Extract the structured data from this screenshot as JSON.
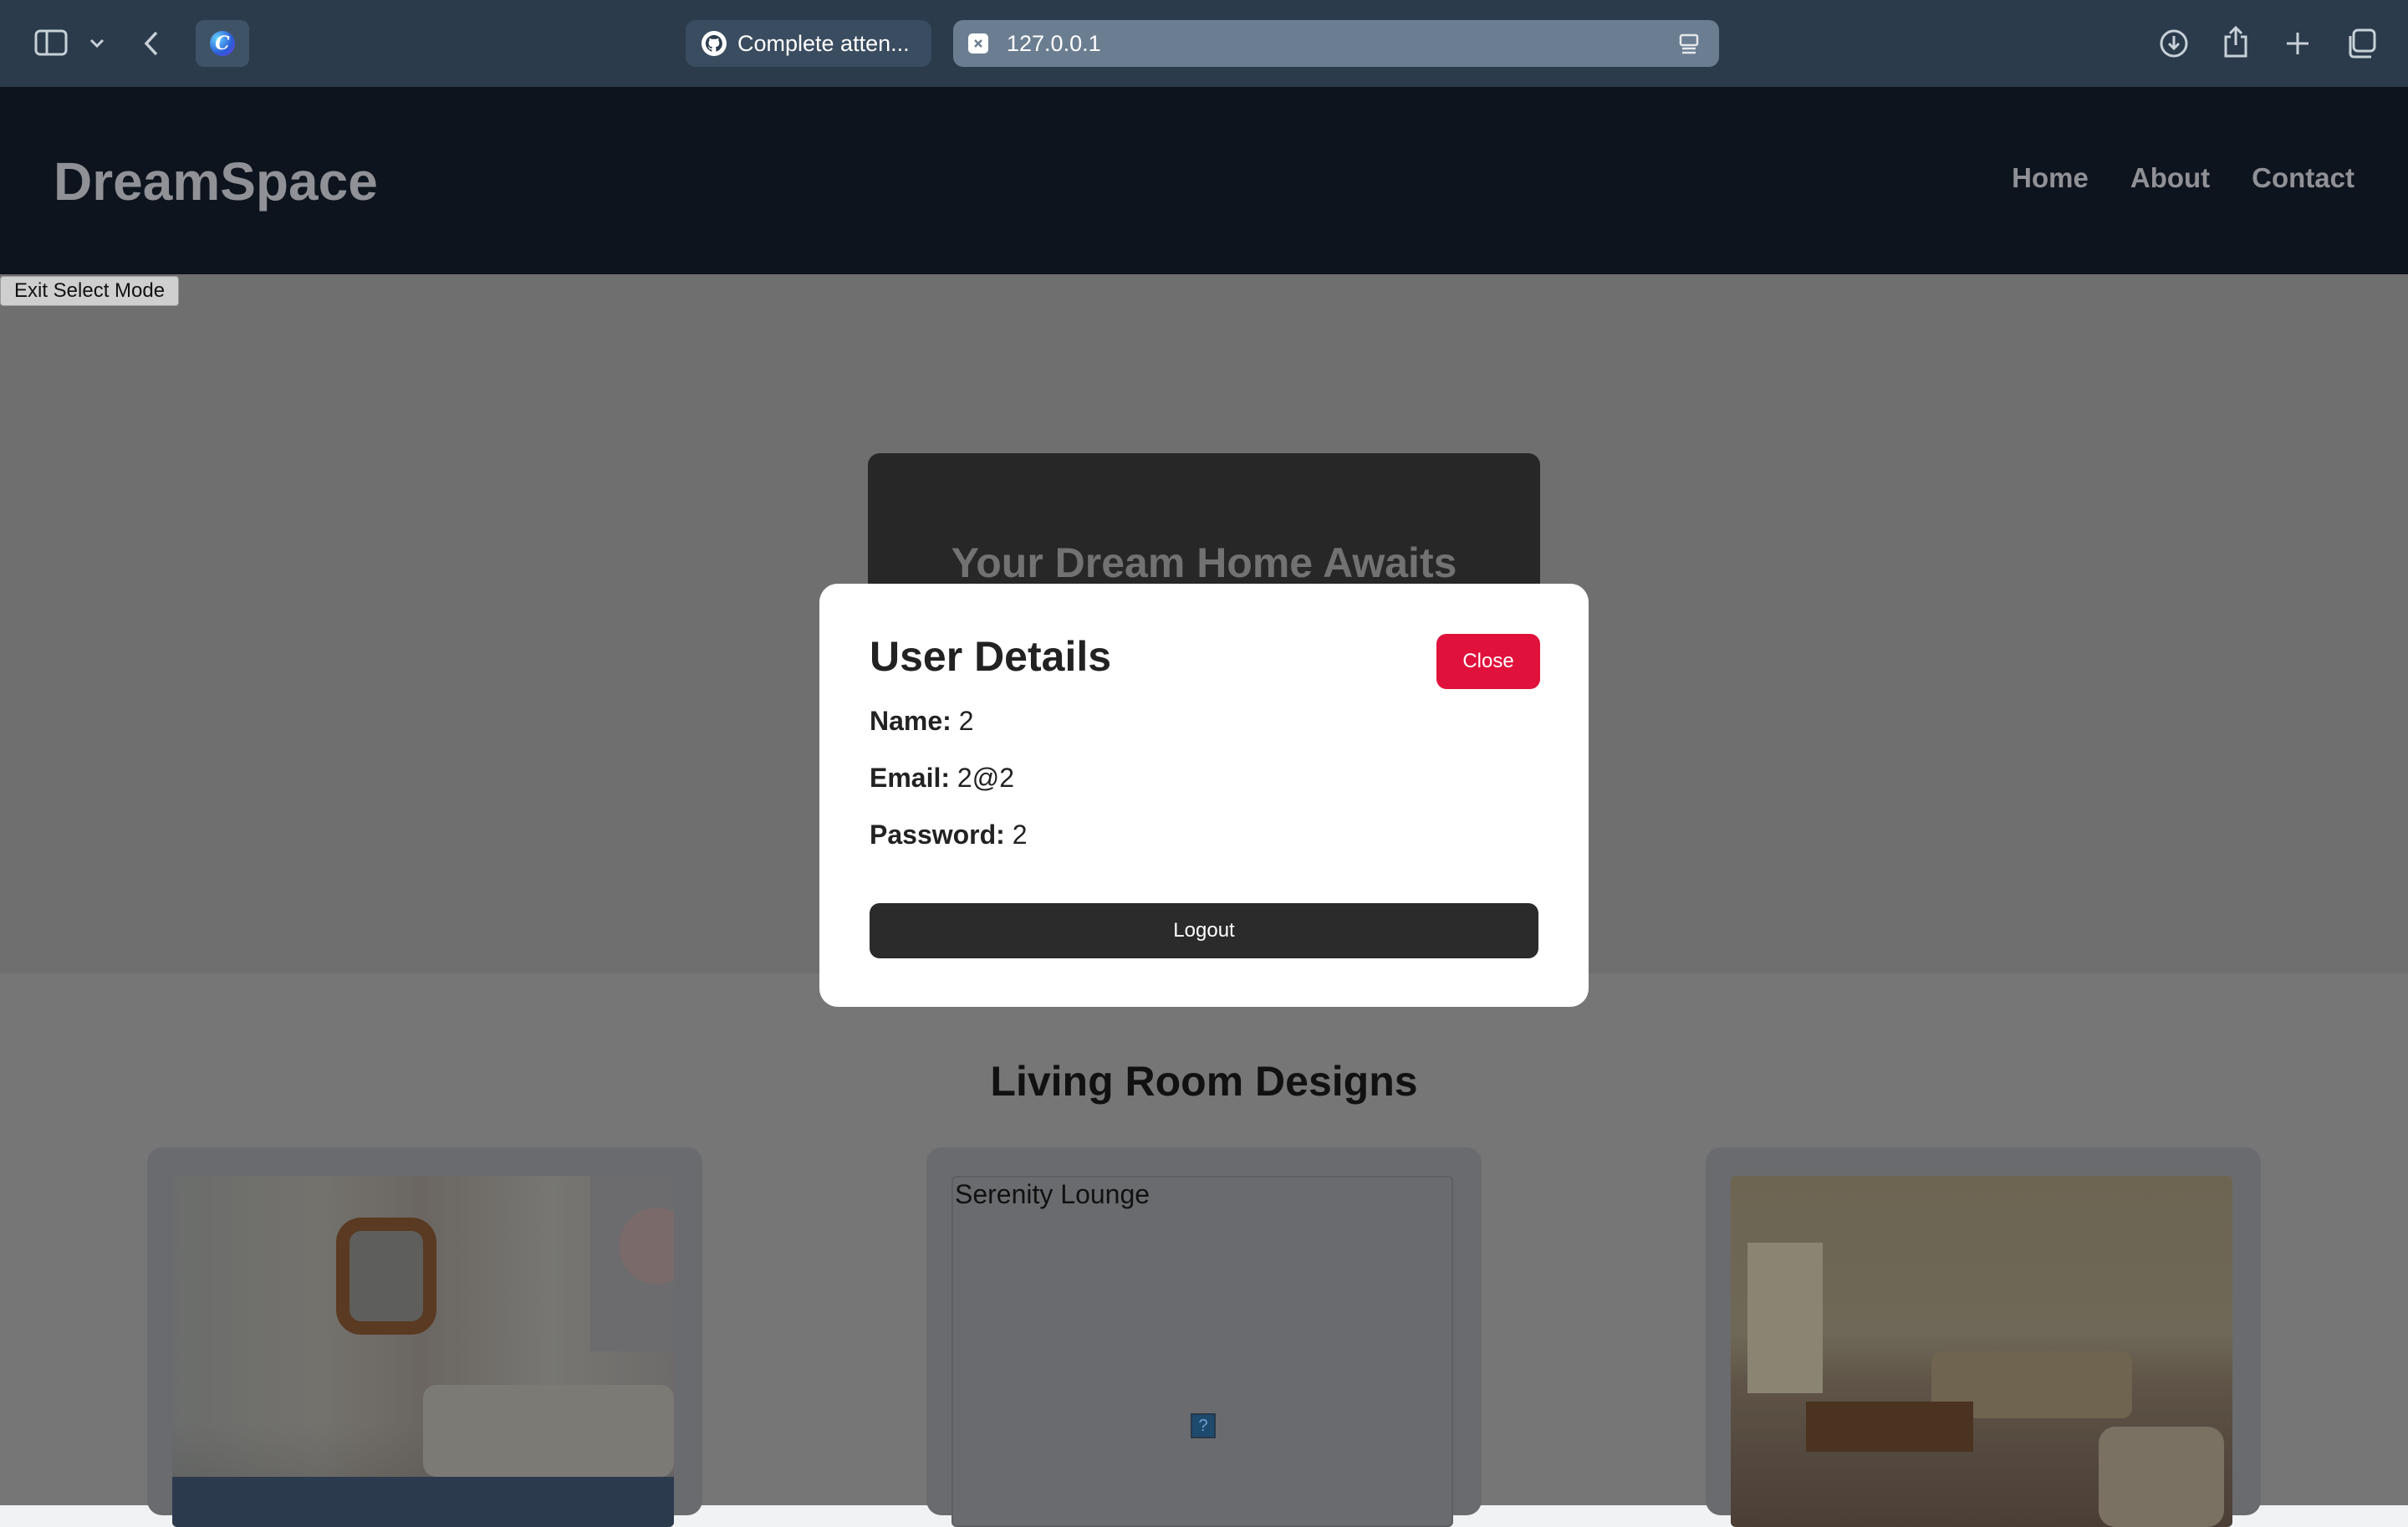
{
  "browser": {
    "tabs": [
      {
        "title": "Complete atten..."
      },
      {
        "title": "127.0.0.1"
      }
    ],
    "icons": {
      "sidebar": "sidebar-icon",
      "chevron": "chevron-down-icon",
      "back": "back-arrow-icon",
      "extension": "extension-icon",
      "download": "download-icon",
      "share": "share-icon",
      "new_tab": "plus-icon",
      "tab_overview": "tab-overview-icon"
    }
  },
  "site": {
    "logo": "DreamSpace",
    "nav": [
      "Home",
      "About",
      "Contact"
    ]
  },
  "overlay_toggle": "Exit Select Mode",
  "hero": {
    "title": "Your Dream Home Awaits"
  },
  "modal": {
    "title": "User Details",
    "close_label": "Close",
    "fields": {
      "name_label": "Name:",
      "name_value": "2",
      "email_label": "Email:",
      "email_value": "2@2",
      "password_label": "Password:",
      "password_value": "2"
    },
    "logout_label": "Logout"
  },
  "section": {
    "title": "Living Room Designs",
    "cards": [
      {
        "alt": ""
      },
      {
        "alt": "Serenity Lounge"
      },
      {
        "alt": ""
      }
    ]
  },
  "colors": {
    "accent_close": "#e0123c",
    "logout_bg": "#2b2b2b",
    "header_bg": "#0e141d",
    "chrome_bg": "#2b3b4c"
  }
}
